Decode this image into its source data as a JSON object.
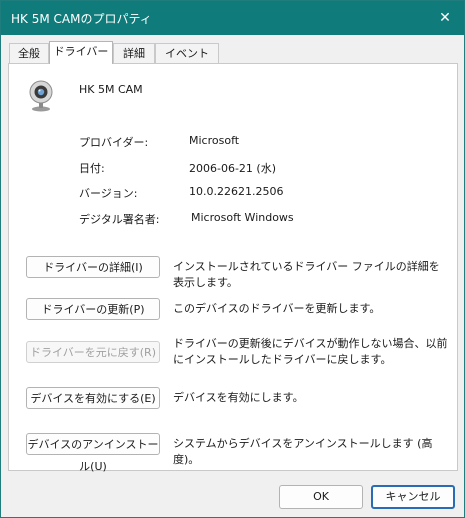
{
  "window": {
    "title": "HK 5M CAMのプロパティ",
    "close_glyph": "✕"
  },
  "tabs": [
    {
      "label": "全般"
    },
    {
      "label": "ドライバー"
    },
    {
      "label": "詳細"
    },
    {
      "label": "イベント"
    }
  ],
  "device": {
    "name": "HK 5M CAM",
    "icon": "webcam-icon"
  },
  "properties": [
    {
      "label": "プロバイダー:",
      "value": "Microsoft"
    },
    {
      "label": "日付:",
      "value": "2006-06-21 (水)"
    },
    {
      "label": "バージョン:",
      "value": "10.0.22621.2506"
    },
    {
      "label": "デジタル署名者:",
      "value": "Microsoft Windows"
    }
  ],
  "actions": [
    {
      "button": "ドライバーの詳細(I)",
      "description": "インストールされているドライバー ファイルの詳細を表示します。"
    },
    {
      "button": "ドライバーの更新(P)",
      "description": "このデバイスのドライバーを更新します。"
    },
    {
      "button": "ドライバーを元に戻す(R)",
      "description": "ドライバーの更新後にデバイスが動作しない場合、以前にインストールしたドライバーに戻します。"
    },
    {
      "button": "デバイスを有効にする(E)",
      "description": "デバイスを有効にします。"
    },
    {
      "button": "デバイスのアンインストール(U)",
      "description": "システムからデバイスをアンインストールします (高度)。"
    }
  ],
  "footer": {
    "ok_label": "OK",
    "cancel_label": "キャンセル"
  },
  "colors": {
    "titlebar": "#0f7b7b",
    "default_button_border": "#2a6bb5"
  }
}
